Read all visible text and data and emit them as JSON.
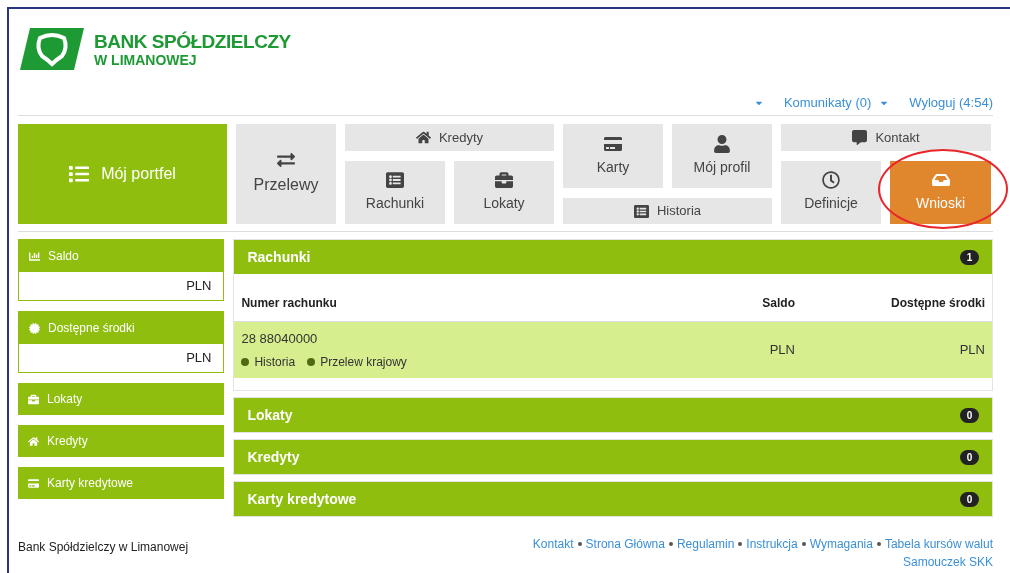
{
  "logo": {
    "line1": "BANK SPÓŁDZIELCZY",
    "line2": "W LIMANOWEJ"
  },
  "user_bar": {
    "messages": "Komunikaty (0)",
    "logout": "Wyloguj (4:54)"
  },
  "portfolio": {
    "label": "Mój portfel",
    "selected": true
  },
  "nav": [
    {
      "kind": "przelewy",
      "label": "Przelewy",
      "selected": false,
      "circled": false
    },
    {
      "kind": "kredyty",
      "label": "Kredyty",
      "selected": false,
      "circled": false
    },
    {
      "kind": "rachunki",
      "label": "Rachunki",
      "selected": false,
      "circled": false
    },
    {
      "kind": "lokaty",
      "label": "Lokaty",
      "selected": false,
      "circled": false
    },
    {
      "kind": "karty",
      "label": "Karty",
      "selected": false,
      "circled": false
    },
    {
      "kind": "profil",
      "label": "Mój profil",
      "selected": false,
      "circled": false
    },
    {
      "kind": "historia",
      "label": "Historia",
      "selected": false,
      "circled": false
    },
    {
      "kind": "kontakt",
      "label": "Kontakt",
      "selected": false,
      "circled": false
    },
    {
      "kind": "definicje",
      "label": "Definicje",
      "selected": false,
      "circled": false
    },
    {
      "kind": "wnioski",
      "label": "Wnioski",
      "selected": true,
      "circled": true
    }
  ],
  "sidebar": [
    {
      "kind": "saldo",
      "label": "Saldo",
      "value": "PLN"
    },
    {
      "kind": "srodki",
      "label": "Dostępne środki",
      "value": "PLN"
    },
    {
      "kind": "lokaty",
      "label": "Lokaty"
    },
    {
      "kind": "kredyty",
      "label": "Kredyty"
    },
    {
      "kind": "karty",
      "label": "Karty kredytowe"
    }
  ],
  "sections": [
    {
      "title": "Rachunki",
      "count": "1",
      "table": {
        "columns": [
          "Numer rachunku",
          "Saldo",
          "Dostępne środki"
        ],
        "rows": [
          {
            "account": "28 88040000",
            "links": [
              "Historia",
              "Przelew krajowy"
            ],
            "balance": "PLN",
            "available": "PLN"
          }
        ]
      }
    },
    {
      "title": "Lokaty",
      "count": "0"
    },
    {
      "title": "Kredyty",
      "count": "0"
    },
    {
      "title": "Karty kredytowe",
      "count": "0"
    }
  ],
  "footer": {
    "bank": "Bank Spółdzielczy w Limanowej",
    "links": [
      "Kontakt",
      "Strona Główna",
      "Regulamin",
      "Instrukcja",
      "Wymagania",
      "Tabela kursów walut"
    ],
    "second_line": "Samouczek SKK"
  }
}
